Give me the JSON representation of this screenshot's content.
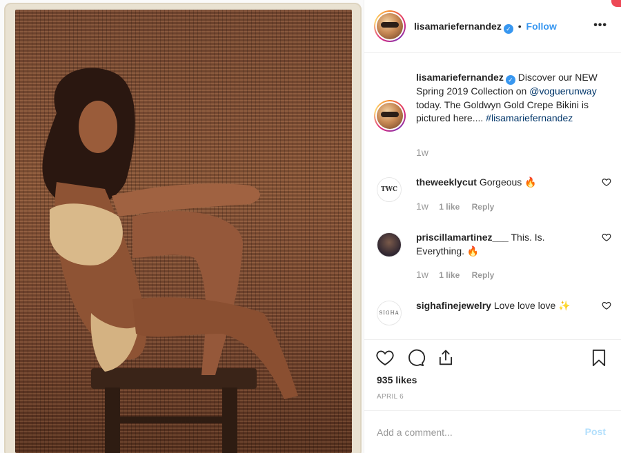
{
  "post": {
    "username": "lisamariefernandez",
    "verified_mark": "✓",
    "separator": "•",
    "follow_label": "Follow",
    "more_label": "•••",
    "caption": {
      "username": "lisamariefernandez",
      "text_1": "Discover our NEW Spring 2019 Collection on",
      "mention": "@voguerunway",
      "text_2": "today. The Goldwyn Gold Crepe Bikini is pictured here....",
      "hashtag": "#lisamariefernandez",
      "time": "1w"
    },
    "comments": [
      {
        "username": "theweeklycut",
        "text": "Gorgeous 🔥",
        "time": "1w",
        "likes": "1 like",
        "reply": "Reply",
        "avatar_text": "TWC"
      },
      {
        "username": "priscillamartinez___",
        "text": "This. Is. Everything. 🔥",
        "time": "1w",
        "likes": "1 like",
        "reply": "Reply"
      },
      {
        "username": "sighafinejewelry",
        "text": "Love love love ✨",
        "avatar_text": "SIGHA"
      }
    ],
    "likes_count": "935 likes",
    "date": "APRIL 6",
    "comment_placeholder": "Add a comment...",
    "post_label": "Post"
  },
  "colors": {
    "accent_blue": "#3897f0",
    "post_disabled": "#b2dffc",
    "muted_text": "#999999",
    "mention_blue": "#003569"
  },
  "icons": [
    "like-icon",
    "comment-icon",
    "share-icon",
    "bookmark-icon",
    "verified-icon",
    "more-options-icon",
    "heart-small-icon"
  ]
}
